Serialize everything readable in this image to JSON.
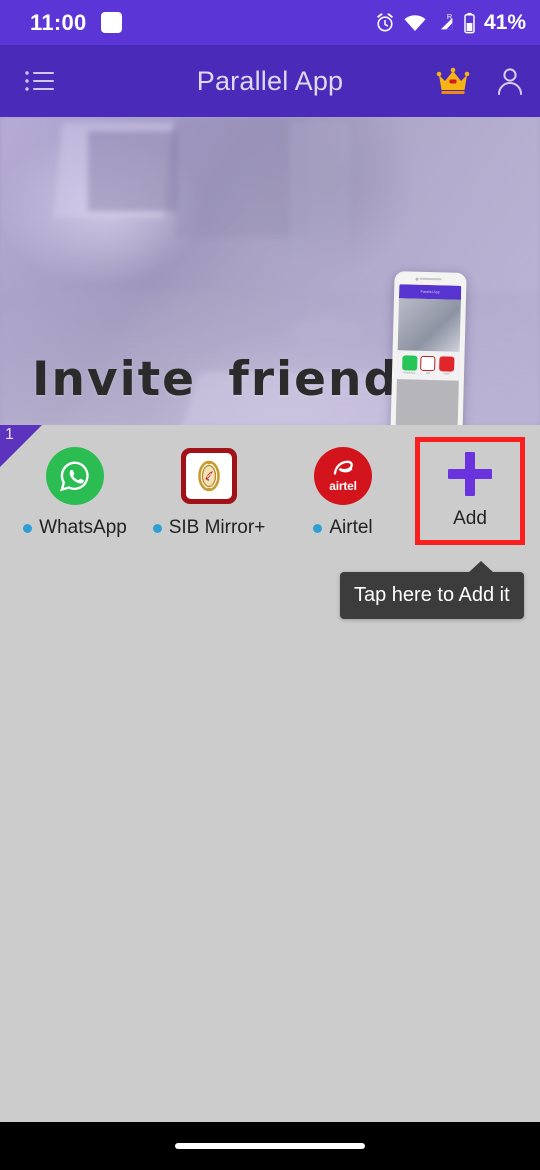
{
  "status_bar": {
    "time": "11:00",
    "notification_icon": "square-notification-icon",
    "alarm_icon": "alarm-clock-icon",
    "wifi_icon": "wifi-icon",
    "signal_icon": "cellular-signal-roaming-icon",
    "roaming_label": "R",
    "battery_icon": "battery-icon",
    "battery_percent": "41%",
    "background_color": "#5b35d6"
  },
  "app_bar": {
    "menu_icon": "list-menu-icon",
    "title": "Parallel App",
    "crown_icon": "crown-premium-icon",
    "profile_icon": "user-profile-icon",
    "background_color": "#4a2ab8"
  },
  "banner": {
    "title": "Invite friends",
    "phone_mockup_icon": "phone-mockup-image",
    "phone_screen_title": "Parallel App",
    "phone_app_labels": [
      "WhatsApp",
      "SIB",
      "Airtel"
    ],
    "tint_color": "#7c60d6"
  },
  "grid": {
    "badge_count": "1",
    "badge_color": "#5c33bc",
    "apps": [
      {
        "label": "WhatsApp",
        "icon": "whatsapp-icon",
        "color": "#2bbd52",
        "has_dot": true
      },
      {
        "label": "SIB Mirror+",
        "icon": "sib-mirror-icon",
        "color": "#a01217",
        "has_dot": true
      },
      {
        "label": "Airtel",
        "icon": "airtel-icon",
        "color": "#d4141c",
        "has_dot": true,
        "wordmark": "airtel"
      }
    ],
    "add_button": {
      "label": "Add",
      "icon": "plus-icon",
      "plus_color": "#6b33dd",
      "highlight_border_color": "#fa1e1e"
    },
    "dot_color": "#2f9ed4",
    "background_color": "#cccccc"
  },
  "tooltip": {
    "text": "Tap here to Add it",
    "background_color": "#3c3c3c"
  },
  "nav_bar": {
    "gesture_pill_icon": "gesture-home-pill",
    "background_color": "#000000"
  }
}
